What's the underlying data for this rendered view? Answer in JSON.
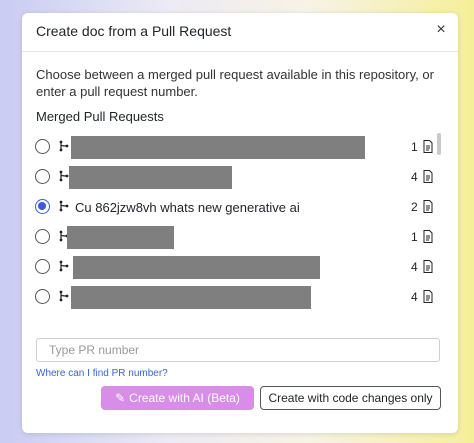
{
  "dialog": {
    "title": "Create doc from a Pull Request",
    "close_label": "×",
    "description": "Choose between a merged pull request available in this repository, or enter a pull request number.",
    "section_title": "Merged Pull Requests"
  },
  "pull_requests": [
    {
      "label": "",
      "count": "1",
      "selected": false,
      "redacted": true
    },
    {
      "label": "",
      "count": "4",
      "selected": false,
      "redacted": true
    },
    {
      "label": "Cu 862jzw8vh whats new generative ai",
      "count": "2",
      "selected": true,
      "redacted": false
    },
    {
      "label": "",
      "count": "1",
      "selected": false,
      "redacted": true
    },
    {
      "label": "",
      "count": "4",
      "selected": false,
      "redacted": true
    },
    {
      "label": "",
      "count": "4",
      "selected": false,
      "redacted": true
    }
  ],
  "pr_input": {
    "value": "",
    "placeholder": "Type PR number"
  },
  "help_link": "Where can I find PR number?",
  "buttons": {
    "create_ai_icon": "✎",
    "create_ai": "Create with AI (Beta)",
    "create_code": "Create with code changes only"
  },
  "colors": {
    "accent": "#3b5bdb",
    "ai_button": "#d88ee8",
    "link": "#3b63d1",
    "redaction": "#7f7f7f"
  },
  "icons": {
    "branch": "git-branch-icon",
    "file": "file-icon",
    "close": "close-icon",
    "sparkle": "magic-wand-icon"
  }
}
